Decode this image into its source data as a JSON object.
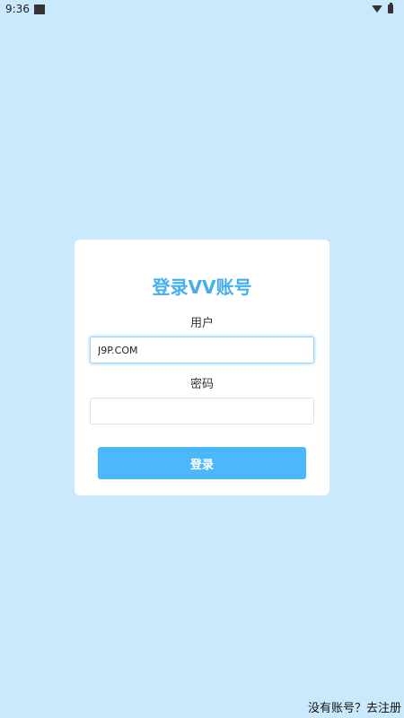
{
  "status_bar": {
    "time": "9:36",
    "icons": [
      "notification-square-icon",
      "wifi-icon",
      "battery-icon"
    ]
  },
  "login_card": {
    "title": "登录VV账号",
    "username_label": "用户",
    "username_value": "J9P.COM",
    "password_label": "密码",
    "password_value": "",
    "login_button_label": "登录"
  },
  "footer": {
    "register_link": "没有账号？去注册"
  },
  "colors": {
    "background": "#cbe9fd",
    "title": "#45aef0",
    "button": "#4bb8fb",
    "card": "#ffffff"
  }
}
